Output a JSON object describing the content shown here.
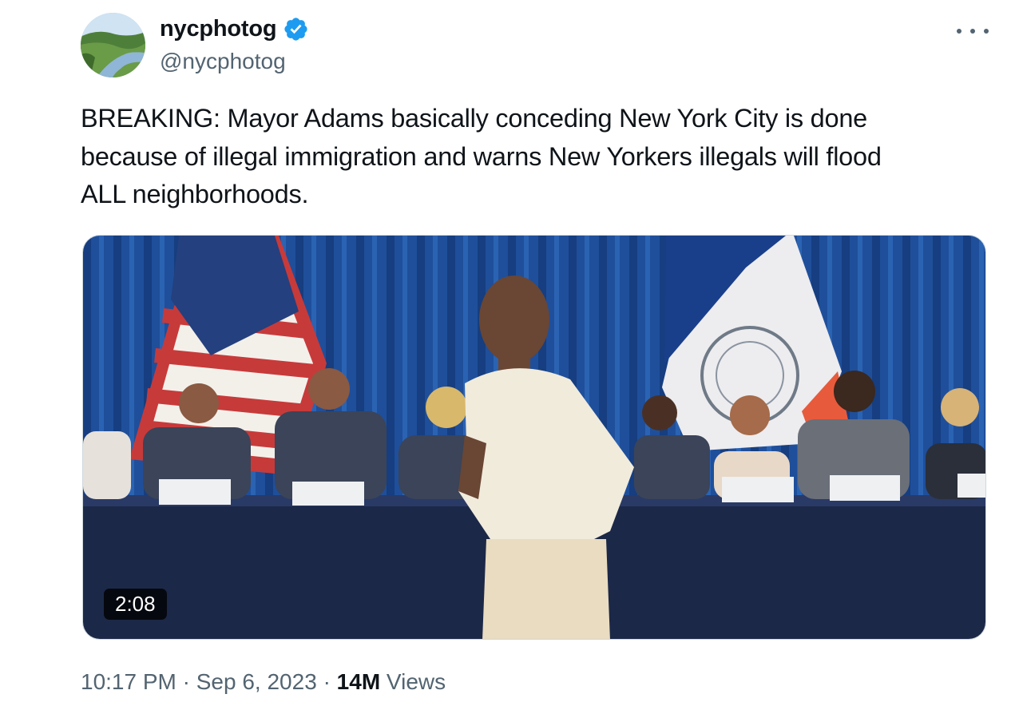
{
  "user": {
    "display_name": "nycphotog",
    "handle": "@nycphotog",
    "verified_icon": "verified-badge-icon",
    "badge_color": "#1d9bf0"
  },
  "menu": {
    "icon": "more-options-icon"
  },
  "tweet": {
    "text": "BREAKING: Mayor Adams basically conceding New York City is done\nbecause of illegal immigration and warns New Yorkers illegals will flood\nALL neighborhoods."
  },
  "media": {
    "type": "video",
    "duration": "2:08"
  },
  "meta": {
    "time": "10:17 PM",
    "separator": "·",
    "date": "Sep 6, 2023",
    "views_count": "14M",
    "views_label": "Views"
  },
  "colors": {
    "text": "#0f1419",
    "secondary": "#536471",
    "accent": "#1d9bf0"
  }
}
